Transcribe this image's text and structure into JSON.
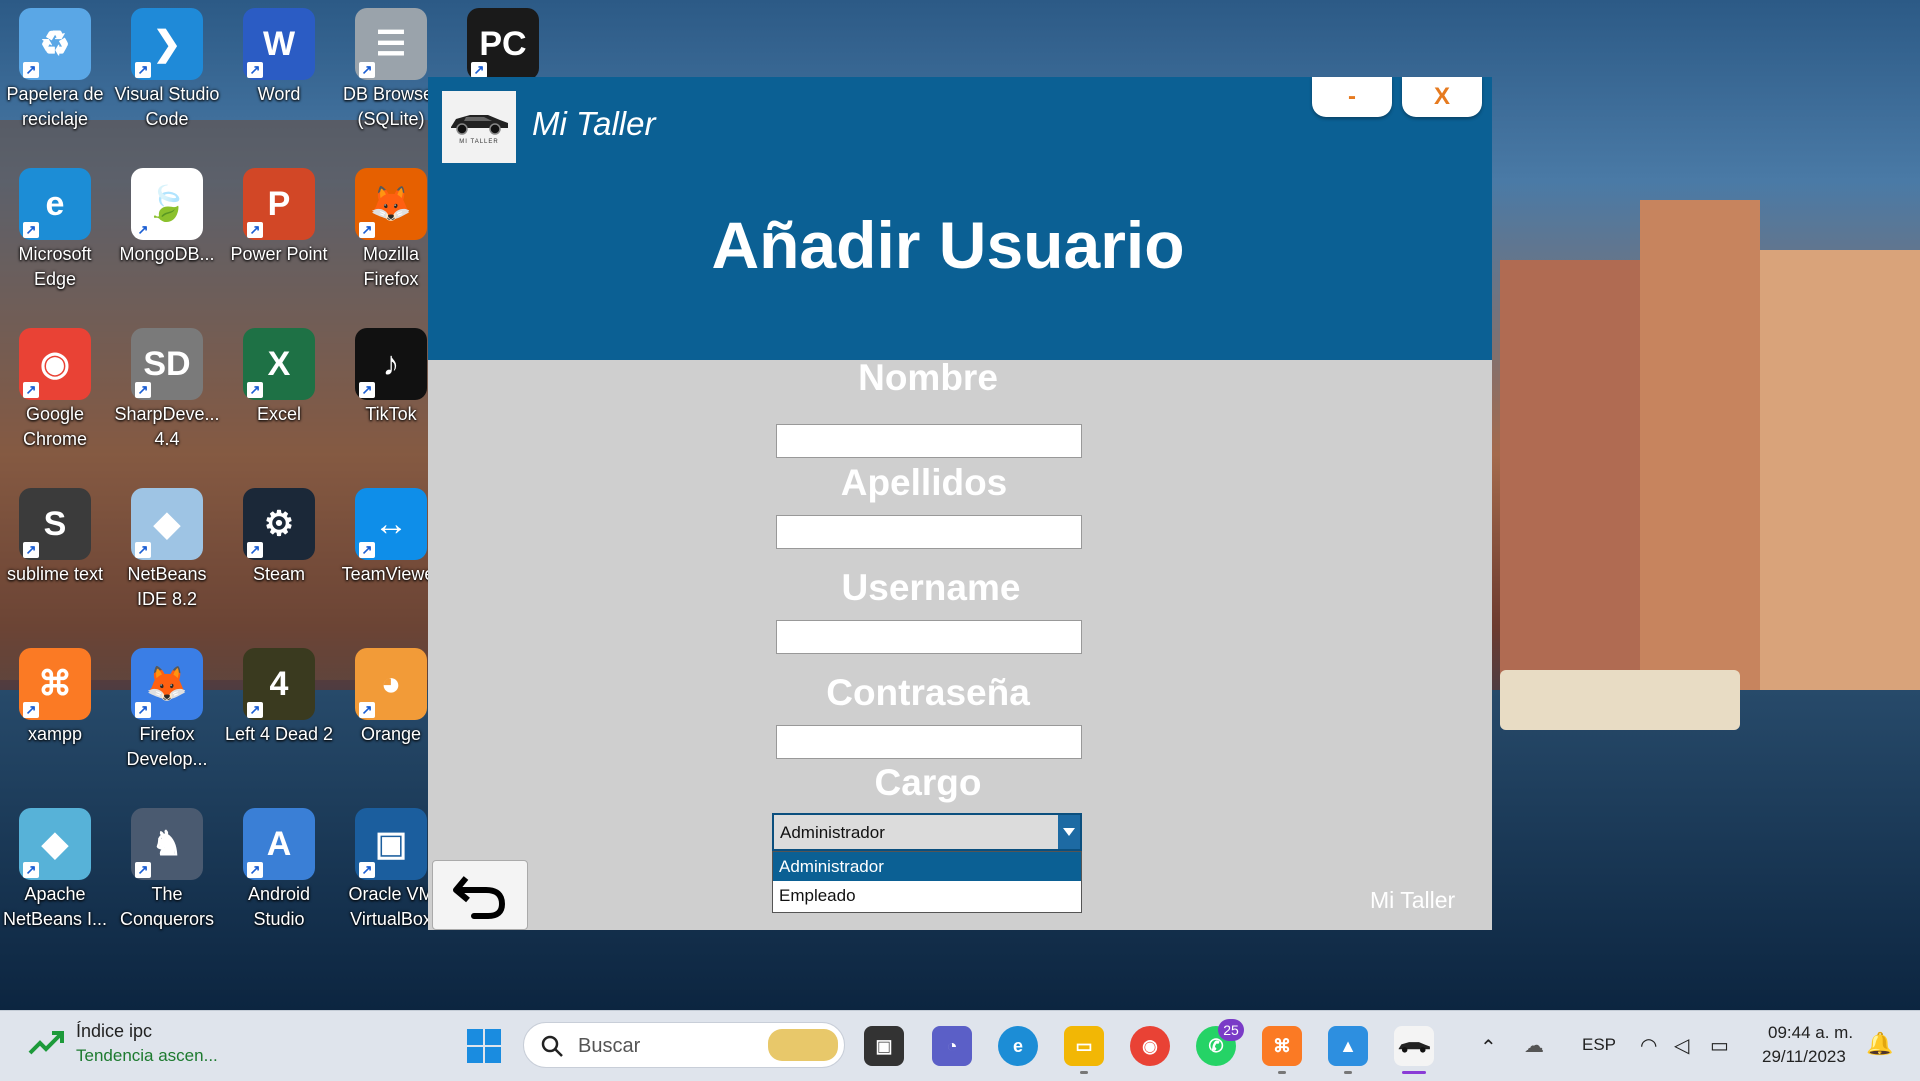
{
  "desktop": {
    "icons": [
      {
        "label": "Papelera de reciclaje",
        "color": "#5aa7e6",
        "glyph": "♻"
      },
      {
        "label": "Visual Studio Code",
        "color": "#1f8ad8",
        "glyph": "❯"
      },
      {
        "label": "Word",
        "color": "#2b5cc4",
        "glyph": "W"
      },
      {
        "label": "DB Browser (SQLite)",
        "color": "#9aa3ab",
        "glyph": "☰"
      },
      {
        "label": "",
        "color": "#1a1a1a",
        "glyph": "PC"
      },
      {
        "label": "Microsoft Edge",
        "color": "#1c8dd6",
        "glyph": "e"
      },
      {
        "label": "MongoDB...",
        "color": "#ffffff",
        "glyph": "🍃"
      },
      {
        "label": "Power Point",
        "color": "#d24726",
        "glyph": "P"
      },
      {
        "label": "Mozilla Firefox",
        "color": "#e66000",
        "glyph": "🦊"
      },
      {
        "label": "Google Chrome",
        "color": "#e94235",
        "glyph": "◉"
      },
      {
        "label": "SharpDeve... 4.4",
        "color": "#7a7a7a",
        "glyph": "SD"
      },
      {
        "label": "Excel",
        "color": "#1e7145",
        "glyph": "X"
      },
      {
        "label": "TikTok",
        "color": "#111111",
        "glyph": "♪"
      },
      {
        "label": "sublime text",
        "color": "#3b3b3b",
        "glyph": "S"
      },
      {
        "label": "NetBeans IDE 8.2",
        "color": "#9ec4e4",
        "glyph": "◆"
      },
      {
        "label": "Steam",
        "color": "#1b2838",
        "glyph": "⚙"
      },
      {
        "label": "TeamViewer",
        "color": "#0e8ee9",
        "glyph": "↔"
      },
      {
        "label": "xampp",
        "color": "#fb7a24",
        "glyph": "⌘"
      },
      {
        "label": "Firefox Develop...",
        "color": "#3a7ee6",
        "glyph": "🦊"
      },
      {
        "label": "Left 4 Dead 2",
        "color": "#3a3a1f",
        "glyph": "4"
      },
      {
        "label": "Orange",
        "color": "#f29b38",
        "glyph": "◕"
      },
      {
        "label": "Apache NetBeans I...",
        "color": "#57b2d8",
        "glyph": "◆"
      },
      {
        "label": "The Conquerors",
        "color": "#4a5a70",
        "glyph": "♞"
      },
      {
        "label": "Android Studio",
        "color": "#3a7fd6",
        "glyph": "A"
      },
      {
        "label": "Oracle VM VirtualBox",
        "color": "#1b5e9e",
        "glyph": "▣"
      }
    ]
  },
  "app": {
    "name": "Mi Taller",
    "logo_caption": "MI TALLER",
    "min_label": "-",
    "close_label": "X",
    "title": "Añadir Usuario",
    "fields": {
      "nombre": {
        "label": "Nombre",
        "value": ""
      },
      "apellidos": {
        "label": "Apellidos",
        "value": ""
      },
      "username": {
        "label": "Username",
        "value": ""
      },
      "password": {
        "label": "Contraseña",
        "value": ""
      }
    },
    "cargo": {
      "label": "Cargo",
      "selected": "Administrador",
      "options": [
        "Administrador",
        "Empleado"
      ]
    },
    "footer_brand": "Mi Taller",
    "colors": {
      "header": "#0b6094",
      "body": "#cfcfcf",
      "accent": "#e67a1f"
    }
  },
  "taskbar": {
    "widget_title": "Índice ipc",
    "widget_subtitle": "Tendencia ascen...",
    "search_placeholder": "Buscar",
    "whatsapp_badge": "25",
    "language": "ESP",
    "time": "09:44 a. m.",
    "date": "29/11/2023"
  }
}
